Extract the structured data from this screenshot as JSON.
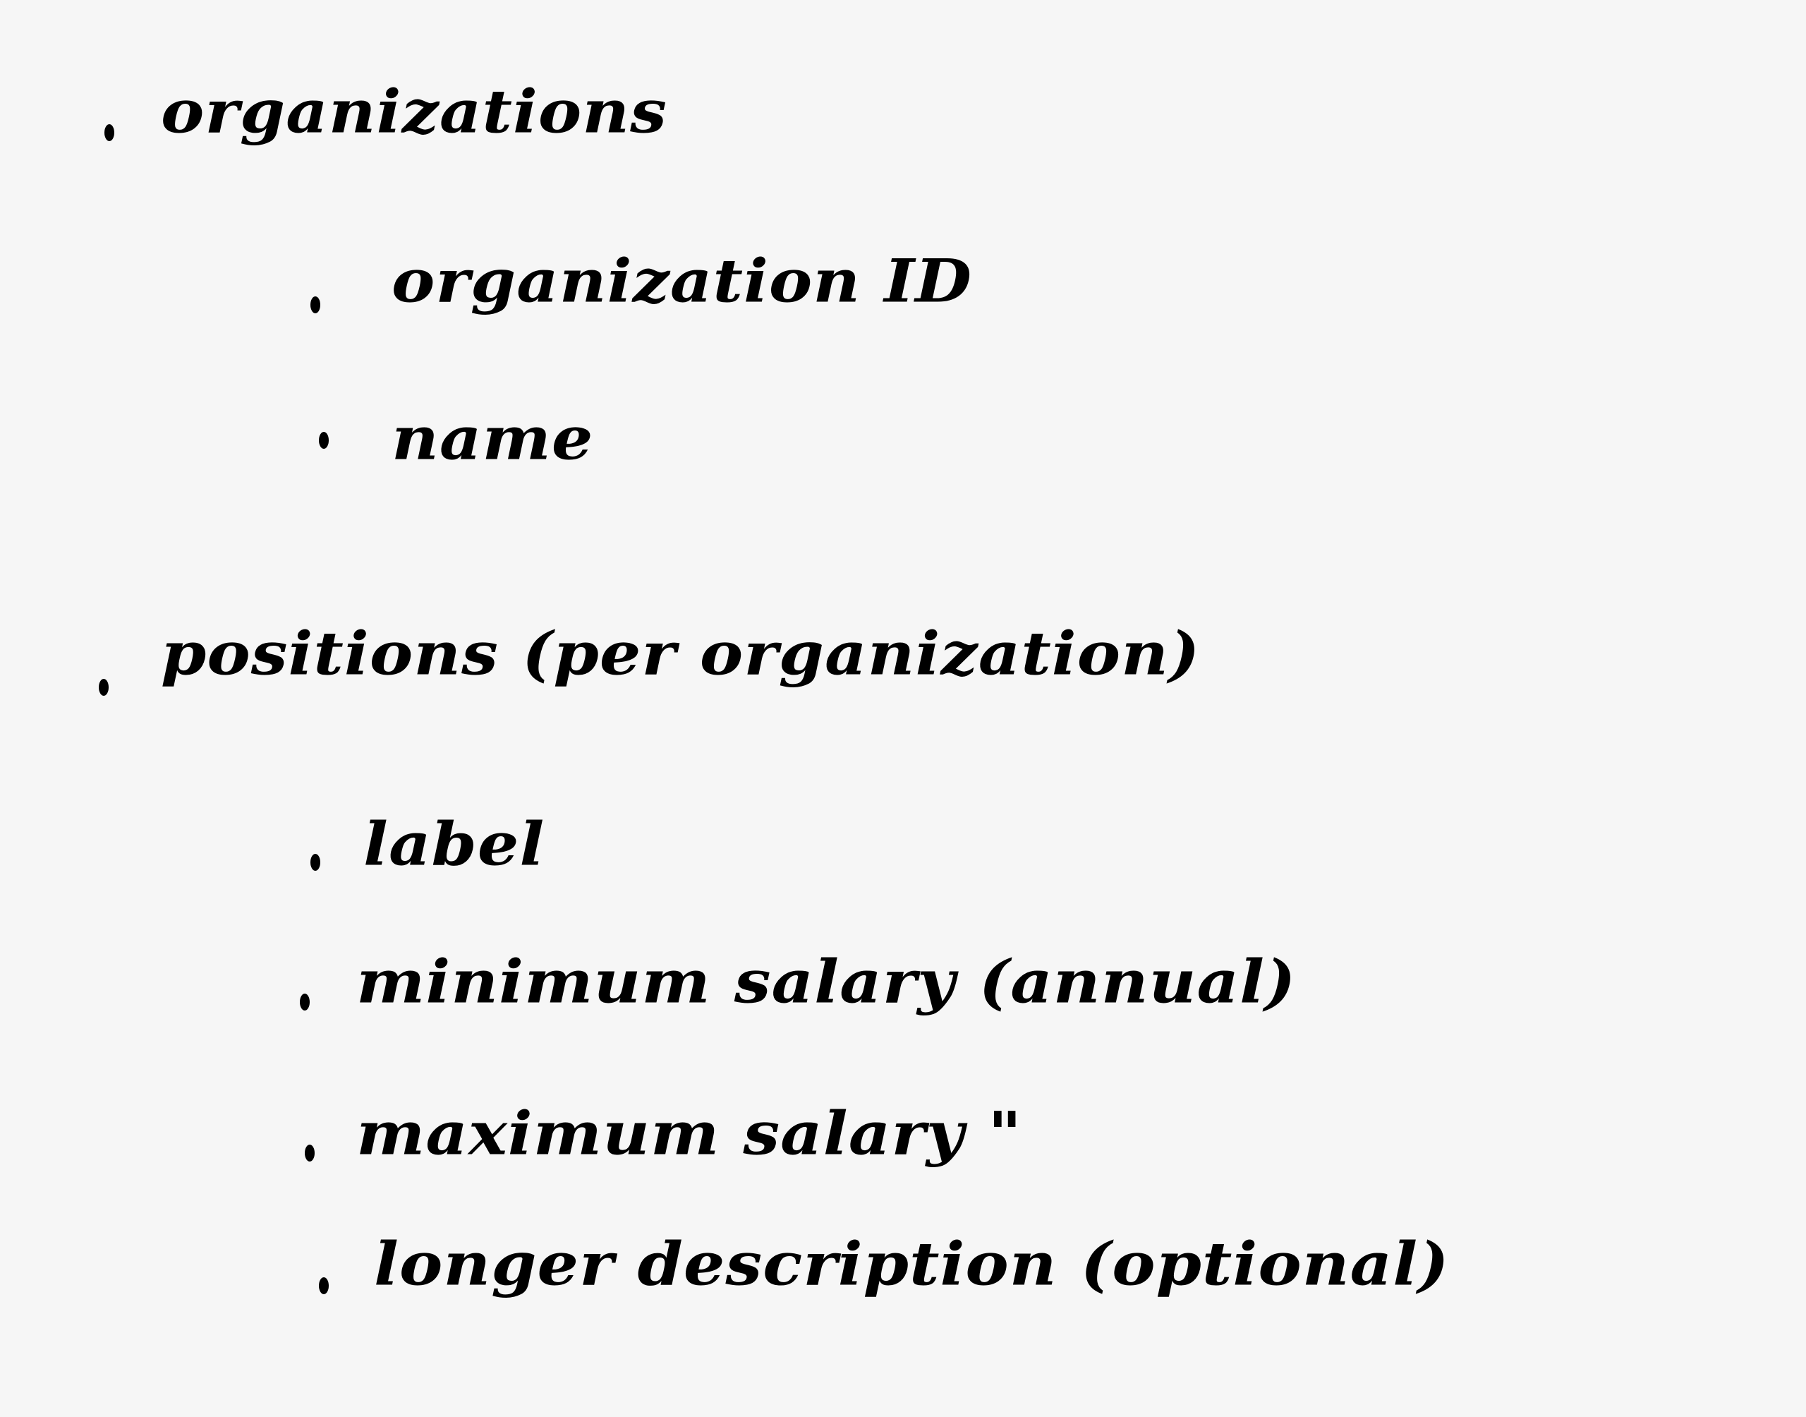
{
  "notes": {
    "items": [
      {
        "text": "organizations",
        "level": 1
      },
      {
        "text": "organization ID",
        "level": 2
      },
      {
        "text": "name",
        "level": 2
      },
      {
        "text": "positions (per organization)",
        "level": 1
      },
      {
        "text": "label",
        "level": 2
      },
      {
        "text": "minimum salary   (annual)",
        "level": 2
      },
      {
        "text": "maximum salary      \"",
        "level": 2
      },
      {
        "text": "longer description   (optional)",
        "level": 2
      }
    ]
  }
}
